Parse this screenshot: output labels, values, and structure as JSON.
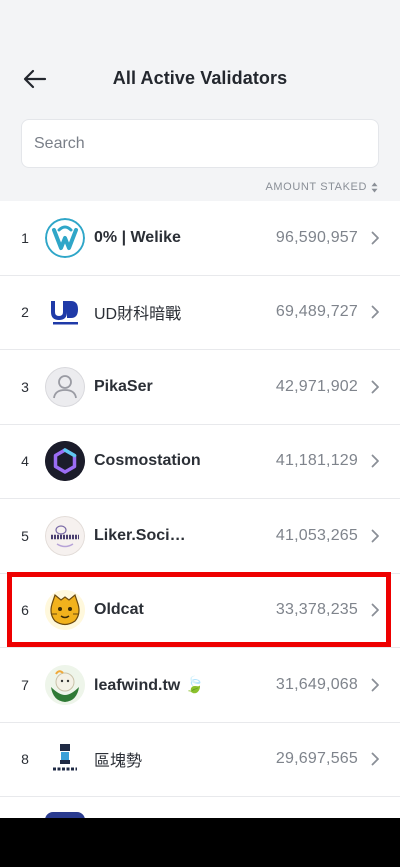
{
  "header": {
    "title": "All Active Validators"
  },
  "search": {
    "placeholder": "Search"
  },
  "sort": {
    "label": "AMOUNT STAKED"
  },
  "validators": [
    {
      "rank": "1",
      "name": "0% | Welike",
      "amount": "96,590,957",
      "icon": "welike-logo-icon"
    },
    {
      "rank": "2",
      "name": "UD財科暗戰",
      "amount": "69,489,727",
      "icon": "udomain-logo-icon"
    },
    {
      "rank": "3",
      "name": "PikaSer",
      "amount": "42,971,902",
      "icon": "default-user-avatar-icon"
    },
    {
      "rank": "4",
      "name": "Cosmostation",
      "amount": "41,181,129",
      "icon": "cosmostation-logo-icon"
    },
    {
      "rank": "5",
      "name": "Liker.Soci…",
      "amount": "41,053,265",
      "icon": "liker-social-logo-icon"
    },
    {
      "rank": "6",
      "name": "Oldcat",
      "amount": "33,378,235",
      "icon": "oldcat-logo-icon"
    },
    {
      "rank": "7",
      "name": "leafwind.tw 🍃",
      "amount": "31,649,068",
      "icon": "leafwind-logo-icon"
    },
    {
      "rank": "8",
      "name": "區塊勢",
      "amount": "29,697,565",
      "icon": "block-trend-logo-icon"
    }
  ],
  "colors": {
    "background": "#f3f4f6",
    "highlight": "#ee0000",
    "text": "#2b2f36",
    "muted": "#7f848c"
  }
}
